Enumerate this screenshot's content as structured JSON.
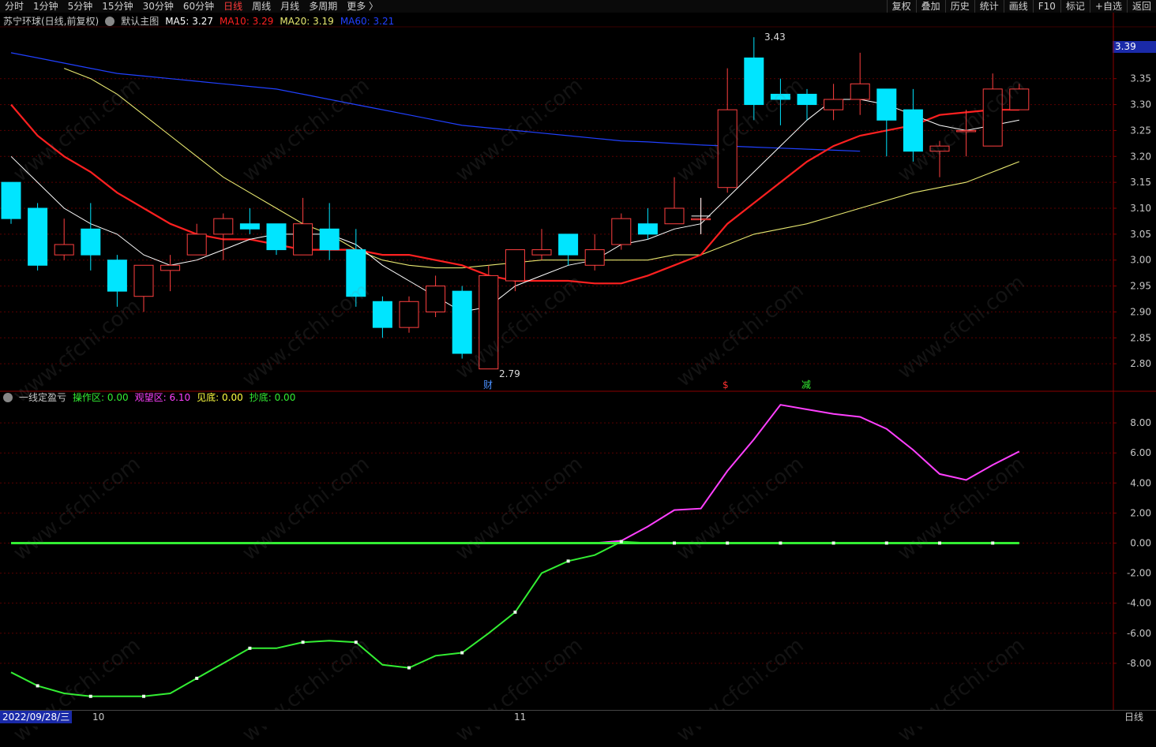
{
  "toolbar": {
    "periods": [
      "分时",
      "1分钟",
      "5分钟",
      "15分钟",
      "30分钟",
      "60分钟",
      "日线",
      "周线",
      "月线",
      "多周期",
      "更多 〉"
    ],
    "active_period": "日线",
    "actions": [
      "复权",
      "叠加",
      "历史",
      "统计",
      "画线",
      "F10",
      "标记",
      "+自选",
      "返回"
    ]
  },
  "main_legend": {
    "title": "苏宁环球(日线,前复权)",
    "indicator": "默认主图",
    "ma5": "MA5: 3.27",
    "ma10": "MA10: 3.29",
    "ma20": "MA20: 3.19",
    "ma60": "MA60: 3.21"
  },
  "sub_legend": {
    "name": "一线定盈亏",
    "op": "操作区: 0.00",
    "watch": "观望区: 6.10",
    "bottom": "见底: 0.00",
    "buy": "抄底: 0.00"
  },
  "annotations": {
    "high": "3.43",
    "low": "2.79",
    "marker_cai": "财",
    "marker_s": "$",
    "marker_jian": "减"
  },
  "current_price": "3.39",
  "price_axis": [
    "3.35",
    "3.30",
    "3.25",
    "3.20",
    "3.15",
    "3.10",
    "3.05",
    "3.00",
    "2.95",
    "2.90",
    "2.85",
    "2.80"
  ],
  "sub_axis": [
    "8.00",
    "6.00",
    "4.00",
    "2.00",
    "0.00",
    "-2.00",
    "-4.00",
    "-6.00",
    "-8.00"
  ],
  "date_label": "2022/09/28/三",
  "month_labels": [
    "10",
    "11"
  ],
  "period_corner": "日线",
  "watermark": "www.cfchi.com",
  "colors": {
    "up": "#ff4040",
    "down": "#00e5ff",
    "ma5": "#ffffff",
    "ma10": "#ff2020",
    "ma20": "#e8e870",
    "ma60": "#2040ff",
    "watch": "#ff40ff",
    "op": "#33ee33"
  },
  "chart_data": {
    "type": "candlestick",
    "candles": [
      {
        "o": 3.15,
        "c": 3.08,
        "h": 3.15,
        "l": 3.07
      },
      {
        "o": 3.1,
        "c": 2.99,
        "h": 3.11,
        "l": 2.98
      },
      {
        "o": 3.01,
        "c": 3.03,
        "h": 3.08,
        "l": 3.0
      },
      {
        "o": 3.06,
        "c": 3.01,
        "h": 3.11,
        "l": 2.98
      },
      {
        "o": 3.0,
        "c": 2.94,
        "h": 3.01,
        "l": 2.91
      },
      {
        "o": 2.93,
        "c": 2.99,
        "h": 2.99,
        "l": 2.9
      },
      {
        "o": 2.98,
        "c": 2.99,
        "h": 3.01,
        "l": 2.94
      },
      {
        "o": 3.01,
        "c": 3.05,
        "h": 3.07,
        "l": 3.01
      },
      {
        "o": 3.05,
        "c": 3.08,
        "h": 3.09,
        "l": 3.0
      },
      {
        "o": 3.07,
        "c": 3.06,
        "h": 3.1,
        "l": 3.05
      },
      {
        "o": 3.07,
        "c": 3.02,
        "h": 3.07,
        "l": 3.01
      },
      {
        "o": 3.01,
        "c": 3.07,
        "h": 3.12,
        "l": 3.01
      },
      {
        "o": 3.06,
        "c": 3.02,
        "h": 3.11,
        "l": 3.0
      },
      {
        "o": 3.02,
        "c": 2.93,
        "h": 3.06,
        "l": 2.91
      },
      {
        "o": 2.92,
        "c": 2.87,
        "h": 2.93,
        "l": 2.85
      },
      {
        "o": 2.87,
        "c": 2.92,
        "h": 2.93,
        "l": 2.86
      },
      {
        "o": 2.9,
        "c": 2.95,
        "h": 2.97,
        "l": 2.89
      },
      {
        "o": 2.94,
        "c": 2.82,
        "h": 2.95,
        "l": 2.81
      },
      {
        "o": 2.79,
        "c": 2.97,
        "h": 2.99,
        "l": 2.79
      },
      {
        "o": 2.96,
        "c": 3.02,
        "h": 3.02,
        "l": 2.94
      },
      {
        "o": 3.01,
        "c": 3.02,
        "h": 3.06,
        "l": 3.0
      },
      {
        "o": 3.05,
        "c": 3.01,
        "h": 3.05,
        "l": 2.99
      },
      {
        "o": 2.99,
        "c": 3.02,
        "h": 3.05,
        "l": 2.98
      },
      {
        "o": 3.03,
        "c": 3.08,
        "h": 3.09,
        "l": 3.02
      },
      {
        "o": 3.07,
        "c": 3.05,
        "h": 3.1,
        "l": 3.04
      },
      {
        "o": 3.07,
        "c": 3.1,
        "h": 3.16,
        "l": 3.07
      },
      {
        "o": 3.08,
        "c": 3.08,
        "h": 3.12,
        "l": 3.05
      },
      {
        "o": 3.14,
        "c": 3.29,
        "h": 3.37,
        "l": 3.13
      },
      {
        "o": 3.39,
        "c": 3.3,
        "h": 3.43,
        "l": 3.27
      },
      {
        "o": 3.32,
        "c": 3.31,
        "h": 3.35,
        "l": 3.26
      },
      {
        "o": 3.32,
        "c": 3.3,
        "h": 3.33,
        "l": 3.27
      },
      {
        "o": 3.29,
        "c": 3.31,
        "h": 3.34,
        "l": 3.27
      },
      {
        "o": 3.31,
        "c": 3.34,
        "h": 3.4,
        "l": 3.28
      },
      {
        "o": 3.33,
        "c": 3.27,
        "h": 3.33,
        "l": 3.2
      },
      {
        "o": 3.29,
        "c": 3.21,
        "h": 3.33,
        "l": 3.19
      },
      {
        "o": 3.21,
        "c": 3.22,
        "h": 3.23,
        "l": 3.16
      },
      {
        "o": 3.25,
        "c": 3.25,
        "h": 3.29,
        "l": 3.2
      },
      {
        "o": 3.22,
        "c": 3.33,
        "h": 3.36,
        "l": 3.22
      },
      {
        "o": 3.29,
        "c": 3.33,
        "h": 3.34,
        "l": 3.29
      }
    ],
    "ma5": [
      3.2,
      3.15,
      3.1,
      3.07,
      3.05,
      3.01,
      2.99,
      3.0,
      3.02,
      3.04,
      3.05,
      3.05,
      3.05,
      3.03,
      2.99,
      2.96,
      2.93,
      2.9,
      2.91,
      2.95,
      2.97,
      2.99,
      3.0,
      3.03,
      3.04,
      3.06,
      3.07,
      3.12,
      3.17,
      3.22,
      3.27,
      3.31,
      3.31,
      3.3,
      3.28,
      3.26,
      3.25,
      3.26,
      3.27
    ],
    "ma10": [
      3.3,
      3.24,
      3.2,
      3.17,
      3.13,
      3.1,
      3.07,
      3.05,
      3.04,
      3.04,
      3.03,
      3.02,
      3.02,
      3.02,
      3.01,
      3.01,
      3.0,
      2.99,
      2.97,
      2.96,
      2.96,
      2.96,
      2.955,
      2.955,
      2.97,
      2.99,
      3.01,
      3.07,
      3.11,
      3.15,
      3.19,
      3.22,
      3.24,
      3.25,
      3.26,
      3.28,
      3.285,
      3.29,
      3.29
    ],
    "ma20": [
      3.37,
      3.35,
      3.32,
      3.28,
      3.24,
      3.2,
      3.16,
      3.13,
      3.1,
      3.07,
      3.05,
      3.02,
      3.0,
      2.99,
      2.985,
      2.985,
      2.99,
      2.995,
      3.0,
      3.0,
      3.0,
      3.0,
      3.0,
      3.01,
      3.01,
      3.03,
      3.05,
      3.06,
      3.07,
      3.085,
      3.1,
      3.115,
      3.13,
      3.14,
      3.15,
      3.17,
      3.19
    ],
    "ma60": [
      3.4,
      3.39,
      3.38,
      3.37,
      3.36,
      3.355,
      3.35,
      3.345,
      3.34,
      3.335,
      3.33,
      3.32,
      3.31,
      3.3,
      3.29,
      3.28,
      3.27,
      3.26,
      3.255,
      3.25,
      3.245,
      3.24,
      3.235,
      3.23,
      3.228,
      3.225,
      3.222,
      3.22,
      3.218,
      3.216,
      3.214,
      3.212,
      3.21
    ],
    "watch": [
      0,
      0,
      0,
      0,
      0,
      0,
      0,
      0,
      0,
      0,
      0,
      0,
      0,
      0,
      0,
      0,
      0,
      0,
      0,
      0,
      0,
      0,
      0,
      0.15,
      1.1,
      2.2,
      2.3,
      4.8,
      6.9,
      9.2,
      8.9,
      8.6,
      8.4,
      7.6,
      6.2,
      4.6,
      4.2,
      5.2,
      6.1
    ],
    "op": [
      -8.6,
      -9.5,
      -10.0,
      -10.2,
      -10.2,
      -10.2,
      -10.0,
      -9.0,
      -8.0,
      -7.0,
      -7.0,
      -6.6,
      -6.5,
      -6.6,
      -8.1,
      -8.3,
      -7.5,
      -7.3,
      -6.0,
      -4.6,
      -2.0,
      -1.2,
      -0.8,
      0.1,
      0,
      0,
      0,
      0,
      0,
      0,
      0,
      0,
      0,
      0,
      0,
      0,
      0,
      0,
      0
    ],
    "price_range": [
      2.75,
      3.45
    ],
    "sub_range": [
      -11,
      10
    ]
  }
}
